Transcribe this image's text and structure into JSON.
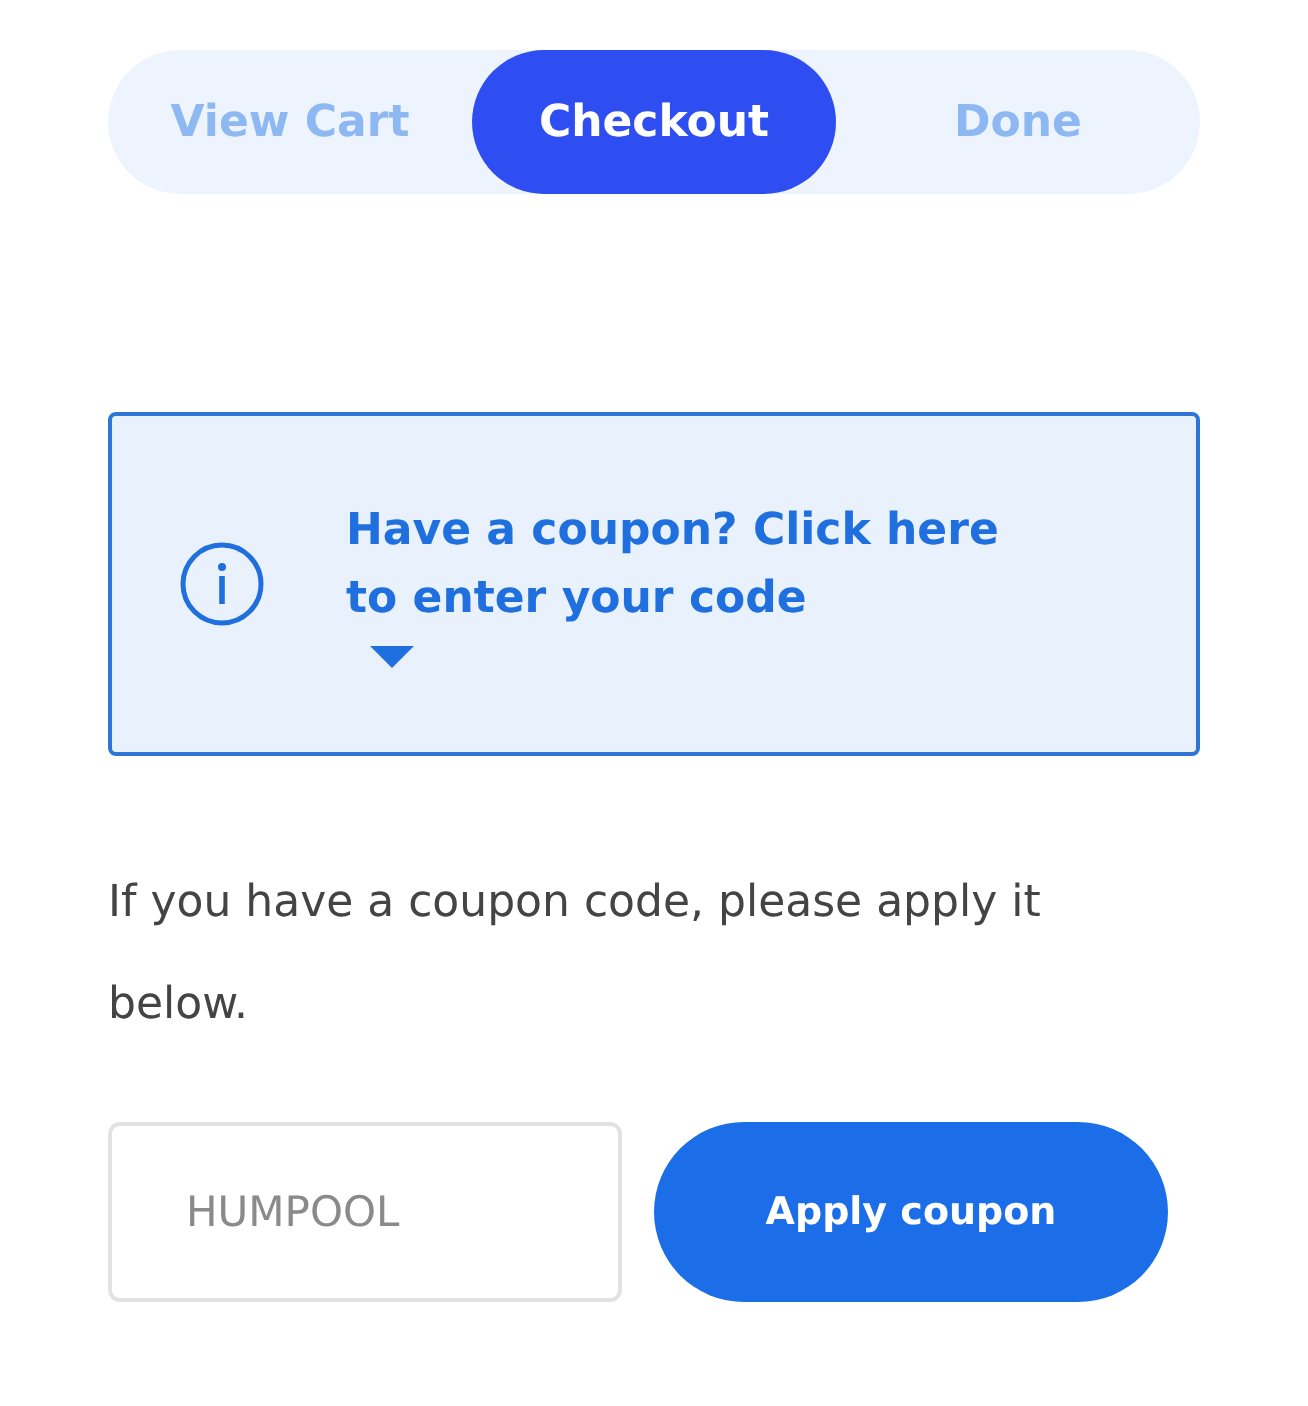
{
  "steps": [
    {
      "label": "View Cart",
      "selected": false
    },
    {
      "label": "Checkout",
      "selected": true
    },
    {
      "label": "Done",
      "selected": false
    }
  ],
  "coupon_notice": {
    "text": "Have a coupon? Click here to enter your code",
    "expanded": true
  },
  "instructions": "If you have a coupon code, please apply it below.",
  "coupon_field": {
    "placeholder": "HUMPOOL"
  },
  "apply_button": "Apply coupon"
}
